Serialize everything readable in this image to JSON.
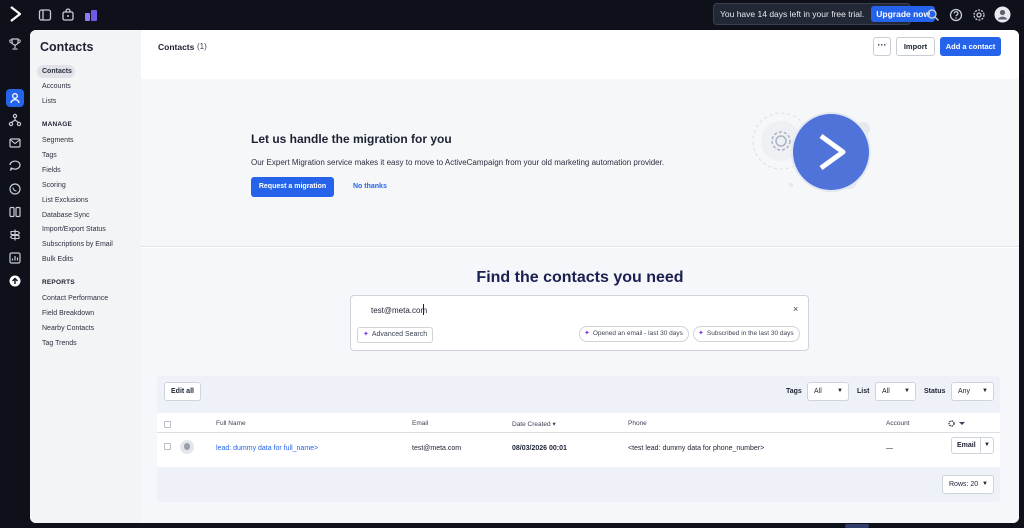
{
  "topbar": {
    "trial_text": "You have 14 days left in your free trial.",
    "upgrade_label": "Upgrade now"
  },
  "sidebar": {
    "title": "Contacts",
    "items": [
      "Contacts",
      "Accounts",
      "Lists"
    ],
    "manage_heading": "MANAGE",
    "manage_items": [
      "Segments",
      "Tags",
      "Fields",
      "Scoring",
      "List Exclusions",
      "Database Sync",
      "Import/Export Status",
      "Subscriptions by Email",
      "Bulk Edits"
    ],
    "reports_heading": "REPORTS",
    "reports_items": [
      "Contact Performance",
      "Field Breakdown",
      "Nearby Contacts",
      "Tag Trends"
    ]
  },
  "header": {
    "title": "Contacts",
    "count": "(1)",
    "more_label": "···",
    "import_label": "Import",
    "add_label": "Add a contact"
  },
  "migration": {
    "title": "Let us handle the migration for you",
    "description": "Our Expert Migration service makes it easy to move to ActiveCampaign from your old marketing automation provider.",
    "request_label": "Request a migration",
    "no_thanks_label": "No thanks"
  },
  "find": {
    "title": "Find the contacts you need",
    "search_value": "test@meta.com",
    "clear_label": "×",
    "advanced_label": "Advanced Search",
    "chips": [
      "Opened an email - last 30 days",
      "Subscribed in the last 30 days"
    ]
  },
  "table": {
    "edit_all_label": "Edit all",
    "filters": {
      "tags_label": "Tags",
      "tags_value": "All",
      "list_label": "List",
      "list_value": "All",
      "status_label": "Status",
      "status_value": "Any"
    },
    "columns": [
      "Full Name",
      "Email",
      "Date Created",
      "Phone",
      "Account"
    ],
    "sort_indicator": "▾",
    "rows": [
      {
        "full_name": "lead: dummy data for full_name>",
        "email": "test@meta.com",
        "date_created": "08/03/2026 00:01",
        "phone": "<test lead: dummy data for phone_number>",
        "account": "—",
        "action_label": "Email"
      }
    ],
    "rows_label": "Rows: 20"
  },
  "colors": {
    "accent": "#2563eb",
    "dark_bg": "#0e1119",
    "find_title": "#1a2050"
  }
}
